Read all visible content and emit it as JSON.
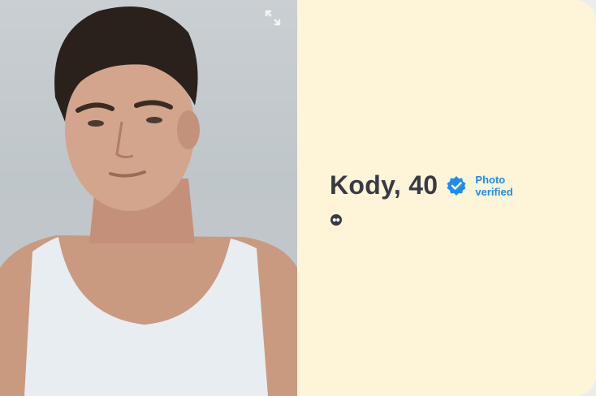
{
  "profile": {
    "name_age": "Kody, 40",
    "verified_label": "Photo verified",
    "photo_alt": "Profile photo of Kody"
  },
  "icons": {
    "expand": "expand-icon",
    "verified": "verified-check-icon",
    "quote": "quote-icon"
  },
  "colors": {
    "info_background": "#fef5d8",
    "name_text": "#3a3a45",
    "verified_blue": "#1c8ef0"
  }
}
